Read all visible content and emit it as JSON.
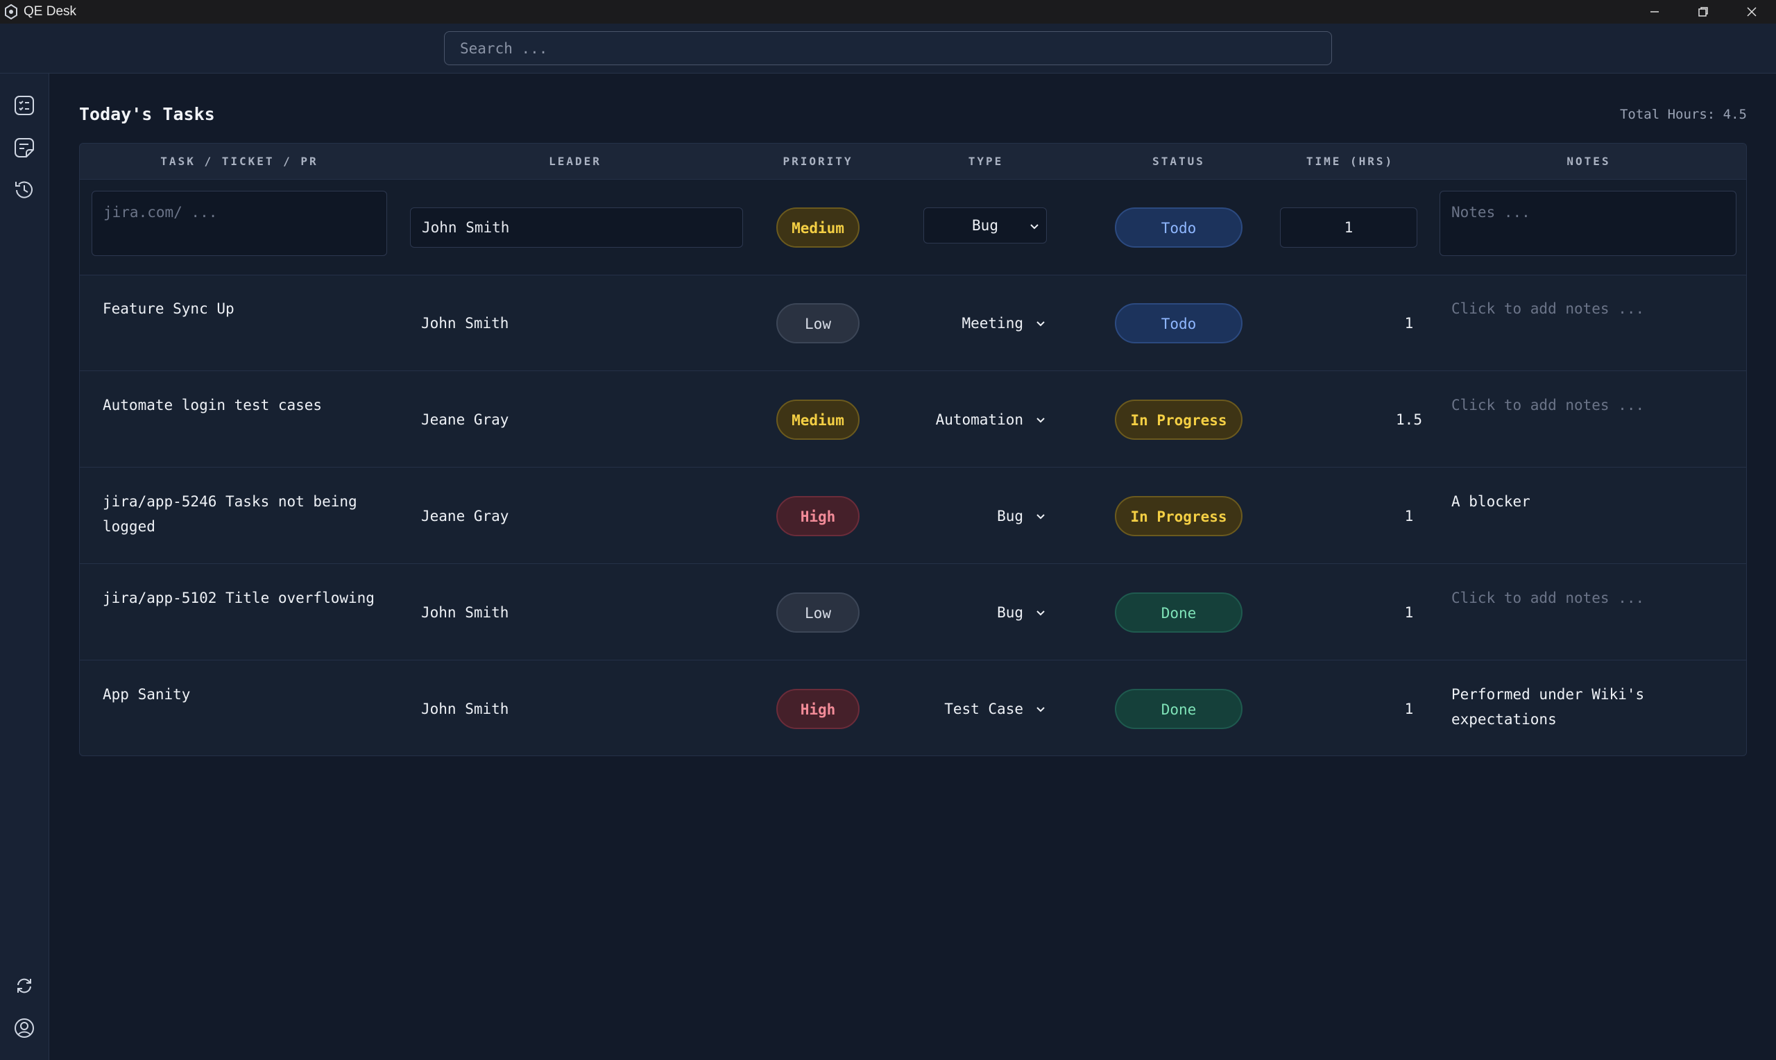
{
  "window": {
    "title": "QE Desk"
  },
  "search": {
    "placeholder": "Search ..."
  },
  "page": {
    "title": "Today's Tasks",
    "total_hours": "Total Hours: 4.5"
  },
  "table": {
    "headers": [
      "TASK / TICKET / PR",
      "LEADER",
      "PRIORITY",
      "TYPE",
      "STATUS",
      "TIME (HRS)",
      "NOTES"
    ],
    "new_row": {
      "task_placeholder": "jira.com/ ...",
      "leader": "John Smith",
      "priority": "Medium",
      "type": "Bug",
      "status": "Todo",
      "hours": "1",
      "notes_placeholder": "Notes ..."
    },
    "rows": [
      {
        "task": "Feature Sync Up",
        "leader": "John Smith",
        "priority": "Low",
        "type": "Meeting",
        "status": "Todo",
        "hours": "1",
        "notes": "Click to add notes ..."
      },
      {
        "task": "Automate login test cases",
        "leader": "Jeane Gray",
        "priority": "Medium",
        "type": "Automation",
        "status": "In Progress",
        "hours": "1.5",
        "notes": "Click to add notes ..."
      },
      {
        "task": "jira/app-5246 Tasks not being logged",
        "leader": "Jeane Gray",
        "priority": "High",
        "type": "Bug",
        "status": "In Progress",
        "hours": "1",
        "notes": "A blocker"
      },
      {
        "task": "jira/app-5102 Title overflowing",
        "leader": "John Smith",
        "priority": "Low",
        "type": "Bug",
        "status": "Done",
        "hours": "1",
        "notes": "Click to add notes ..."
      },
      {
        "task": "App Sanity",
        "leader": "John Smith",
        "priority": "High",
        "type": "Test Case",
        "status": "Done",
        "hours": "1",
        "notes": "Performed under Wiki's expectations"
      }
    ]
  },
  "sidebar": {
    "top_icons": [
      "tasks-list-icon",
      "notes-icon",
      "history-icon"
    ],
    "bottom_icons": [
      "sync-icon",
      "profile-icon"
    ]
  },
  "colors": {
    "background": "#121a29",
    "panel": "#172131",
    "priority_low": "#2a3241",
    "priority_medium": "#f4cf44",
    "priority_high": "#f28b98",
    "status_todo": "#8fb7ff",
    "status_in_progress": "#f4cf44",
    "status_done": "#7fe3b8"
  }
}
